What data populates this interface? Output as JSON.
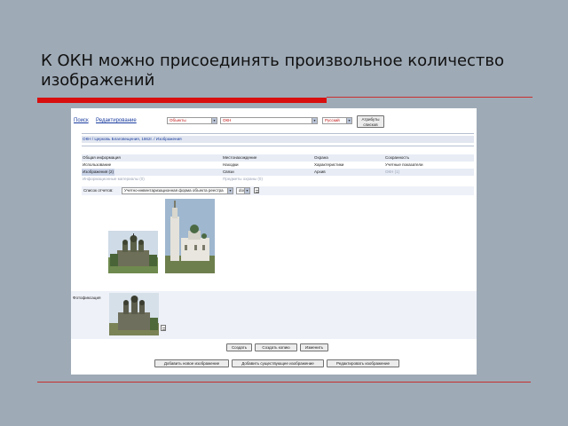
{
  "slide": {
    "title": "К ОКН можно присоединять произвольное количество изображений"
  },
  "toolbar": {
    "search_link": "Поиск",
    "edit_link": "Редактирование",
    "objects_select": "Объекты",
    "okn_select": "ОКН",
    "lang_select": "Русский",
    "attributes_button": "Атрибуты списков"
  },
  "breadcrumb": "ОКН / Церковь Благовещения, 1662г. / Изображения",
  "nav": {
    "row1": [
      "Общая информация",
      "Местонахождение",
      "Охрана",
      "Сохранность"
    ],
    "row2": [
      "Использование",
      "Находки",
      "Характеристики",
      "Учетные показатели"
    ],
    "row3": [
      "Изображения (2)",
      "Связи",
      "Архив",
      "ОКН (1)"
    ],
    "row4": [
      "Информационные материалы (0)",
      "Предметы охраны (0)"
    ]
  },
  "report": {
    "label": "Список отчетов:",
    "select": "Учетно-инвентаризационная форма объекта реестра",
    "format": "doc"
  },
  "fixation_label": "Фотофиксация",
  "actions": {
    "row1": [
      "Создать",
      "Создать копию",
      "Изменить"
    ],
    "row2": [
      "Добавить новое изображение",
      "Добавить существующее изображение",
      "Редактировать изображение"
    ]
  },
  "colors": {
    "background": "#9eaab6",
    "accent_red": "#d80e0e",
    "link_blue": "#1a3c9e"
  }
}
